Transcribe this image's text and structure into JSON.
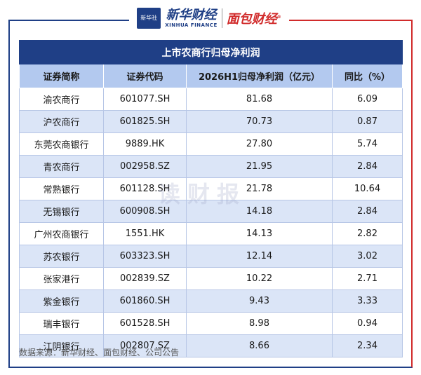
{
  "logos": {
    "xinhua_badge": "新华社",
    "xinhua_cn": "新华财经",
    "xinhua_en": "XINHUA FINANCE",
    "mianbao": "面包财经"
  },
  "table": {
    "title": "上市农商行归母净利润",
    "headers": [
      "证券简称",
      "证券代码",
      "2026H1归母净利润（亿元）",
      "同比（%）"
    ],
    "rows": [
      [
        "渝农商行",
        "601077.SH",
        "81.68",
        "6.09"
      ],
      [
        "沪农商行",
        "601825.SH",
        "70.73",
        "0.87"
      ],
      [
        "东莞农商银行",
        "9889.HK",
        "27.80",
        "5.74"
      ],
      [
        "青农商行",
        "002958.SZ",
        "21.95",
        "2.84"
      ],
      [
        "常熟银行",
        "601128.SH",
        "21.78",
        "10.64"
      ],
      [
        "无锡银行",
        "600908.SH",
        "14.18",
        "2.84"
      ],
      [
        "广州农商银行",
        "1551.HK",
        "14.13",
        "2.82"
      ],
      [
        "苏农银行",
        "603323.SH",
        "12.14",
        "3.02"
      ],
      [
        "张家港行",
        "002839.SZ",
        "10.22",
        "2.71"
      ],
      [
        "紫金银行",
        "601860.SH",
        "9.43",
        "3.33"
      ],
      [
        "瑞丰银行",
        "601528.SH",
        "8.98",
        "0.94"
      ],
      [
        "江阴银行",
        "002807.SZ",
        "8.66",
        "2.34"
      ]
    ]
  },
  "watermark": "读财报",
  "source": "数据来源：新华财经、面包财经、公司公告",
  "colors": {
    "header_blue": "#1f3f86",
    "subheader": "#b3c9ef",
    "stripe": "#dbe5f7",
    "accent_red": "#d12b2b"
  }
}
